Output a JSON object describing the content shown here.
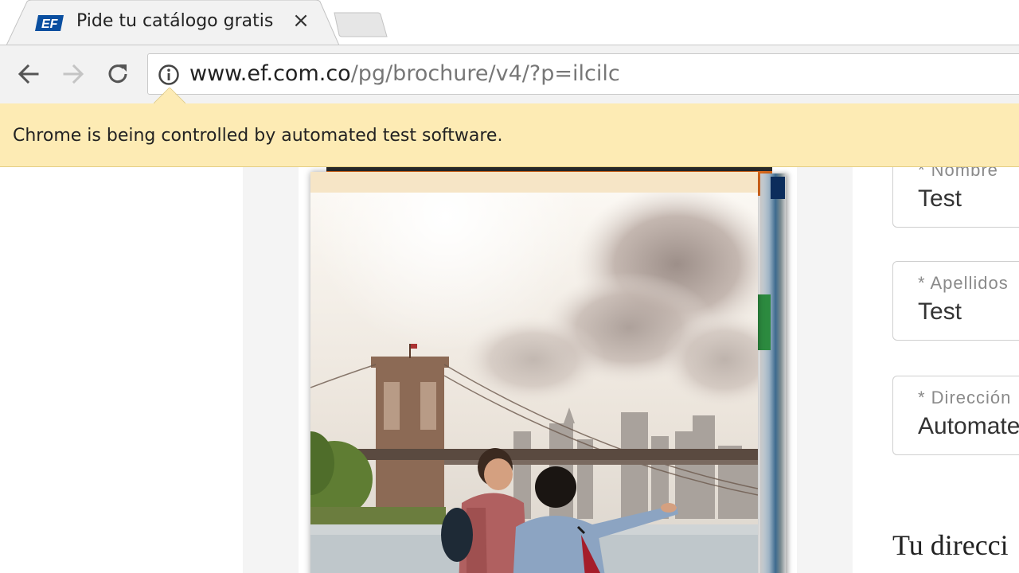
{
  "browser": {
    "tab": {
      "favicon": "ef-logo-icon",
      "title": "Pide tu catálogo gratis",
      "close_glyph": "×"
    },
    "address_bar": {
      "host": "www.ef.com.co",
      "path": "/pg/brochure/v4/?p=ilcilc"
    },
    "infobar": {
      "message": "Chrome is being controlled by automated test software."
    },
    "icons": [
      "back-arrow-icon",
      "forward-arrow-icon",
      "reload-icon",
      "info-icon"
    ]
  },
  "form": {
    "fields": [
      {
        "label": "* Nombre",
        "value": "Test"
      },
      {
        "label": "* Apellidos",
        "value": "Test"
      },
      {
        "label": "* Dirección",
        "value": "Automate"
      }
    ],
    "section_heading": "Tu direcci"
  },
  "colors": {
    "infobar": "#fdebb4",
    "toolbar": "#f2f2f2",
    "brochure_accent": "#e8701e"
  }
}
